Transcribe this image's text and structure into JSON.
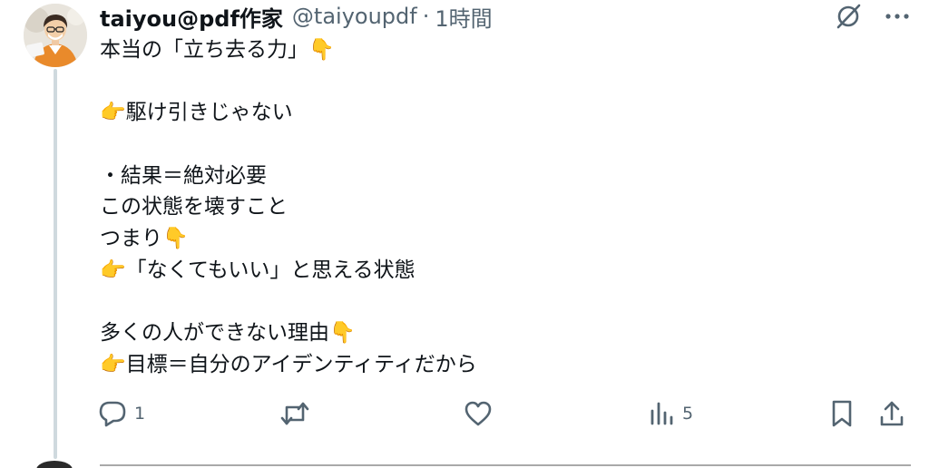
{
  "post": {
    "display_name": "taiyou@pdf作家",
    "handle": "@taiyoupdf",
    "separator": "·",
    "time": "1時間",
    "body_lines": [
      "本当の「立ち去る力」👇",
      "",
      "👉駆け引きじゃない",
      "",
      "・結果＝絶対必要",
      "この状態を壊すこと",
      "つまり👇",
      "👉「なくてもいい」と思える状態",
      "",
      "多くの人ができない理由👇",
      "👉目標＝自分のアイデンティティだから"
    ]
  },
  "actions": {
    "reply_count": "1",
    "repost_count": "",
    "like_count": "",
    "views_count": "5"
  },
  "icons": {
    "grok": "grok-icon",
    "more": "more-icon",
    "reply": "reply-icon",
    "repost": "repost-icon",
    "like": "like-icon",
    "views": "views-icon",
    "bookmark": "bookmark-icon",
    "share": "share-icon"
  },
  "colors": {
    "text": "#0f1419",
    "secondary": "#536471",
    "thread_line": "#cfd9de"
  }
}
